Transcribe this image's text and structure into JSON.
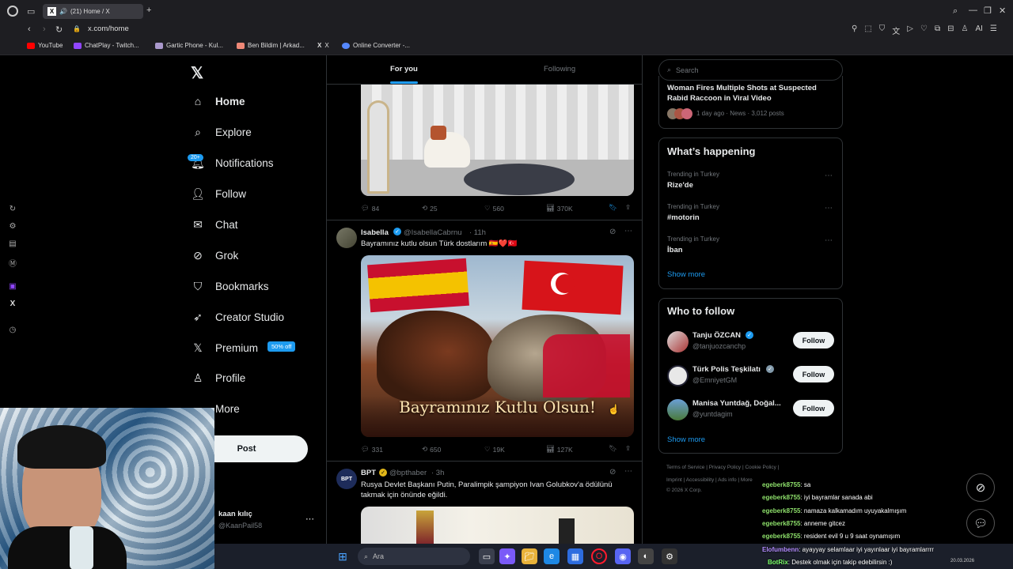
{
  "browser": {
    "tab_title": "(21) Home / X",
    "url": "x.com/home",
    "bookmarks": [
      "YouTube",
      "ChatPlay - Twitch...",
      "Gartic Phone - Kul...",
      "Ben Bildim | Arkad...",
      "X",
      "Online Converter -..."
    ],
    "ai_label": "AI"
  },
  "nav": {
    "items": [
      {
        "label": "Home",
        "icon": "home-icon"
      },
      {
        "label": "Explore",
        "icon": "search-icon"
      },
      {
        "label": "Notifications",
        "icon": "bell-icon",
        "badge": "20+"
      },
      {
        "label": "Follow",
        "icon": "person-add-icon"
      },
      {
        "label": "Chat",
        "icon": "envelope-icon"
      },
      {
        "label": "Grok",
        "icon": "grok-icon"
      },
      {
        "label": "Bookmarks",
        "icon": "bookmark-icon"
      },
      {
        "label": "Creator Studio",
        "icon": "rocket-icon"
      },
      {
        "label": "Premium",
        "icon": "x-icon",
        "badge": "50% off"
      },
      {
        "label": "Profile",
        "icon": "person-icon"
      },
      {
        "label": "More",
        "icon": "more-icon"
      }
    ],
    "post_label": "Post",
    "account_name": "kaan kılıç",
    "account_handle": "@KaanPail58"
  },
  "feed": {
    "tabs": [
      "For you",
      "Following"
    ],
    "post0": {
      "replies": "84",
      "reposts": "25",
      "likes": "560",
      "views": "370K"
    },
    "post1": {
      "name": "Isabella",
      "handle": "@IsabellaCabrnu",
      "time": "· 11h",
      "text": "Bayramınız kutlu olsun Türk dostlarım 🇪🇸❤️🇹🇷",
      "image_caption": "Bayramınız Kutlu Olsun!",
      "replies": "331",
      "reposts": "650",
      "likes": "19K",
      "views": "127K"
    },
    "post2": {
      "name": "BPT",
      "handle": "@bpthaber",
      "time": "· 3h",
      "text_line1": "Rusya Devlet Başkanı Putin, Paralimpik şampiyon Ivan Golubkov'a ödülünü",
      "text_line2": "takmak için önünde eğildi."
    }
  },
  "right": {
    "search_placeholder": "Search",
    "news_title_1": "Woman Fires Multiple Shots at Suspected",
    "news_title_2": "Rabid Raccoon in Viral Video",
    "news_meta": "1 day ago · News · 3,012 posts",
    "happening_title": "What’s happening",
    "trends": [
      {
        "context": "Trending in Turkey",
        "name": "Rize'de"
      },
      {
        "context": "Trending in Turkey",
        "name": "#motorin"
      },
      {
        "context": "Trending in Turkey",
        "name": "İban"
      }
    ],
    "show_more": "Show more",
    "who_title": "Who to follow",
    "follow_label": "Follow",
    "who": [
      {
        "name": "Tanju ÖZCAN",
        "handle": "@tanjuozcanchp"
      },
      {
        "name": "Türk Polis Teşkilatı",
        "handle": "@EmniyetGM"
      },
      {
        "name": "Manisa Yuntdağ, Doğal...",
        "handle": "@yuntdagim"
      }
    ],
    "footer_line1": "Terms of Service | Privacy Policy | Cookie Policy |",
    "footer_line2": "Imprint | Accessibility | Ads info | More",
    "footer_line3": "© 2026 X Corp."
  },
  "stream_chat": [
    {
      "user": "egeberk8755",
      "msg": ": sa"
    },
    {
      "user": "egeberk8755",
      "msg": ": iyi bayramlar sanada abi"
    },
    {
      "user": "egeberk8755",
      "msg": ": namaza kalkamadım uyuyakalmışım"
    },
    {
      "user": "egeberk8755",
      "msg": ": anneme gitcez"
    },
    {
      "user": "egeberk8755",
      "msg": ": resident evil 9 u 9 saat oynamışım"
    },
    {
      "user": "Elofumbenn",
      "msg": ": ayayyay selamlaar iyi yayınlaar iyi bayramlarrrr"
    },
    {
      "user": "BotRix",
      "msg": ": Destek olmak için takip edebilirsin :)"
    }
  ],
  "taskbar": {
    "search_placeholder": "Ara",
    "date": "20.03.2026"
  },
  "colors": {
    "accent": "#1d9bf0",
    "chat_user": "#8ee06b"
  }
}
